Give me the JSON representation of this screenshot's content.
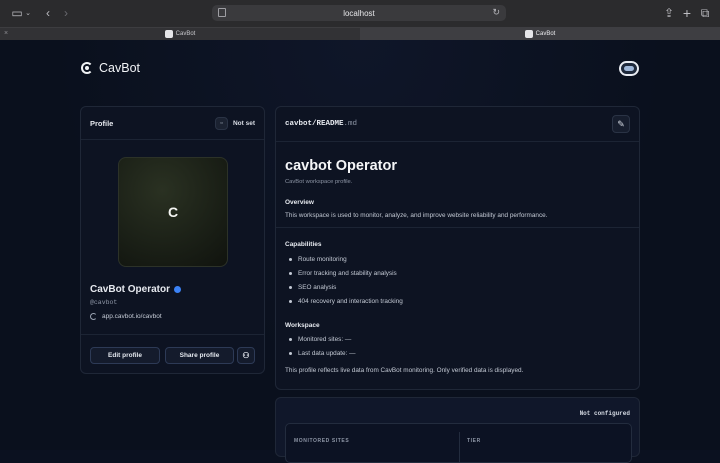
{
  "browser": {
    "url": "localhost",
    "tabs": [
      {
        "label": "CavBot"
      },
      {
        "label": "CavBot"
      }
    ]
  },
  "brand": {
    "name": "CavBot"
  },
  "profile": {
    "title": "Profile",
    "status": "Not set",
    "initial": "C",
    "name": "CavBot Operator",
    "handle": "@cavbot",
    "link": "app.cavbot.io/cavbot",
    "edit_label": "Edit profile",
    "share_label": "Share profile"
  },
  "readme": {
    "path": "cavbot/README",
    "ext": ".md",
    "title": "cavbot Operator",
    "subtitle": "CavBot workspace profile.",
    "overview_heading": "Overview",
    "overview_text": "This workspace is used to monitor, analyze, and improve website reliability and performance.",
    "capabilities_heading": "Capabilities",
    "capabilities": [
      "Route monitoring",
      "Error tracking and stability analysis",
      "SEO analysis",
      "404 recovery and interaction tracking"
    ],
    "workspace_heading": "Workspace",
    "workspace_items": [
      "Monitored sites: —",
      "Last data update: —"
    ],
    "footer_text": "This profile reflects live data from CavBot monitoring. Only verified data is displayed."
  },
  "stats": {
    "status": "Not configured",
    "monitored_label": "MONITORED SITES",
    "tier_label": "TIER"
  },
  "colors": {
    "background": "#0b1120",
    "card": "#0d1322",
    "accent_verified": "#3b82f6"
  }
}
